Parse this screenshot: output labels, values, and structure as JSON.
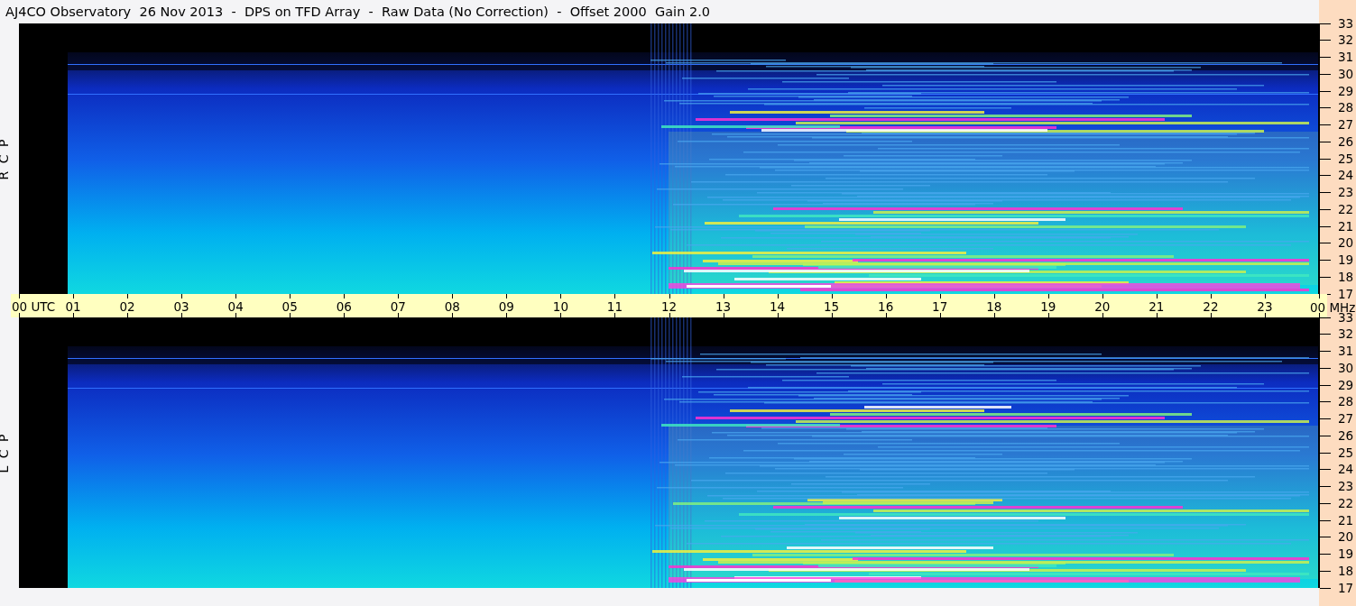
{
  "title": "AJ4CO Observatory  26 Nov 2013  -  DPS on TFD Array  -  Raw Data (No Correction)  -  Offset 2000  Gain 2.0",
  "panels": [
    {
      "label": "R C P",
      "frequency_ticks": [
        "33",
        "32",
        "31",
        "30",
        "29",
        "28",
        "27",
        "26",
        "25",
        "24",
        "23",
        "22",
        "21",
        "20",
        "19",
        "18",
        "17"
      ]
    },
    {
      "label": "L C P",
      "frequency_ticks": [
        "33",
        "32",
        "31",
        "30",
        "29",
        "28",
        "27",
        "26",
        "25",
        "24",
        "23",
        "22",
        "21",
        "20",
        "19",
        "18",
        "17"
      ]
    }
  ],
  "time_axis": {
    "labels": [
      "00 UTC",
      "01",
      "02",
      "03",
      "04",
      "05",
      "06",
      "07",
      "08",
      "09",
      "10",
      "11",
      "12",
      "13",
      "14",
      "15",
      "16",
      "17",
      "18",
      "19",
      "20",
      "21",
      "22",
      "23",
      "00 MHz"
    ]
  }
}
